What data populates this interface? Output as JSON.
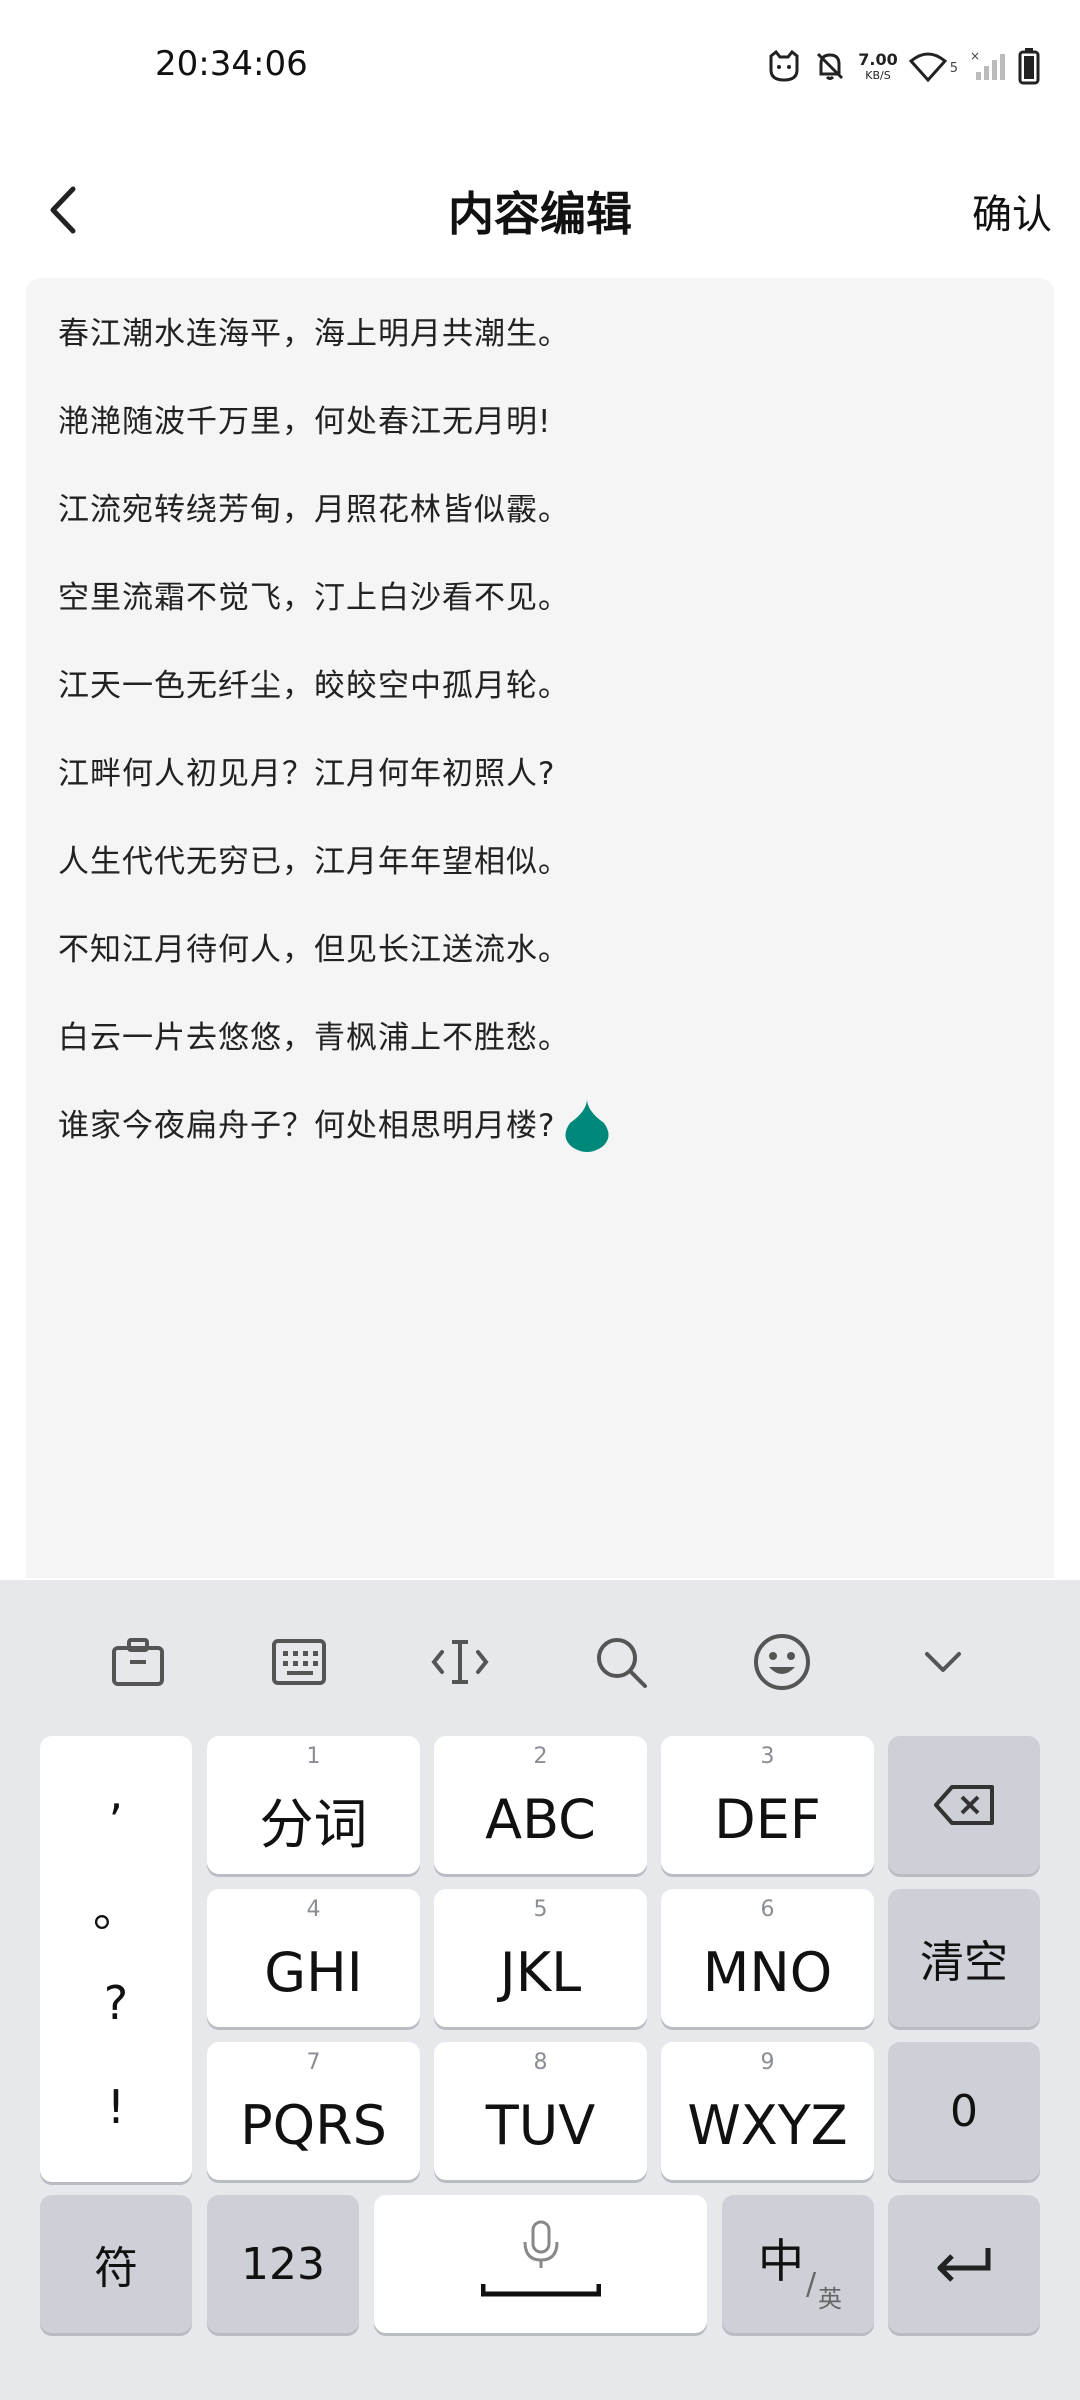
{
  "status": {
    "time": "20:34:06",
    "net_speed_value": "7.00",
    "net_speed_unit": "KB/S",
    "sim_slot": "5"
  },
  "header": {
    "title": "内容编辑",
    "confirm_label": "确认"
  },
  "editor": {
    "lines": [
      "春江潮水连海平，海上明月共潮生。",
      "滟滟随波千万里，何处春江无月明!",
      "江流宛转绕芳甸，月照花林皆似霰。",
      "空里流霜不觉飞，汀上白沙看不见。",
      "江天一色无纤尘，皎皎空中孤月轮。",
      "江畔何人初见月？江月何年初照人?",
      "人生代代无穷已，江月年年望相似。",
      "不知江月待何人，但见长江送流水。",
      "白云一片去悠悠，青枫浦上不胜愁。",
      "谁家今夜扁舟子？何处相思明月楼?"
    ],
    "cursor_color": "#00897b"
  },
  "keyboard": {
    "punctuation": [
      ",",
      "。",
      "?",
      "!"
    ],
    "keys": [
      {
        "num": "1",
        "label": "分词"
      },
      {
        "num": "2",
        "label": "ABC"
      },
      {
        "num": "3",
        "label": "DEF"
      },
      {
        "num": "4",
        "label": "GHI"
      },
      {
        "num": "5",
        "label": "JKL"
      },
      {
        "num": "6",
        "label": "MNO"
      },
      {
        "num": "7",
        "label": "PQRS"
      },
      {
        "num": "8",
        "label": "TUV"
      },
      {
        "num": "9",
        "label": "WXYZ"
      }
    ],
    "clear_label": "清空",
    "zero_label": "0",
    "symbol_label": "符",
    "numbers_label": "123",
    "lang_main": "中",
    "lang_alt": "英"
  }
}
